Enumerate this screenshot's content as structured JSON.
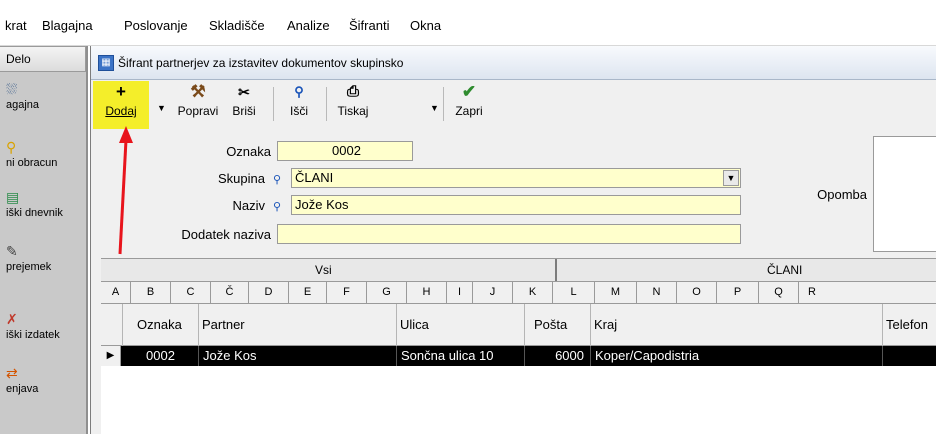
{
  "menubar": {
    "items": [
      "krat",
      "Blagajna",
      "Poslovanje",
      "Skladišče",
      "Analize",
      "Šifranti",
      "Okna"
    ]
  },
  "leftpanel": {
    "header": "Delo",
    "items": [
      {
        "label": "agajna",
        "icon": "cash-register-icon"
      },
      {
        "label": "ni obracun",
        "icon": "key-icon"
      },
      {
        "label": "iški dnevnik",
        "icon": "ledger-icon"
      },
      {
        "label": "prejemek",
        "icon": "receipt-icon"
      },
      {
        "label": "iški izdatek",
        "icon": "expense-icon"
      },
      {
        "label": "enjava",
        "icon": "exchange-icon"
      }
    ]
  },
  "window": {
    "title": "Šifrant partnerjev za izstavitev dokumentov skupinsko"
  },
  "toolbar": {
    "dodaj": "Dodaj",
    "popravi": "Popravi",
    "brisi": "Briši",
    "isci": "Išči",
    "tiskaj": "Tiskaj",
    "zapri": "Zapri",
    "highlight_color": "#f4ee2a"
  },
  "form": {
    "oznaka_label": "Oznaka",
    "oznaka_value": "0002",
    "skupina_label": "Skupina",
    "skupina_value": "ČLANI",
    "naziv_label": "Naziv",
    "naziv_value": "Jože Kos",
    "dodatek_label": "Dodatek naziva",
    "dodatek_value": "",
    "opomba_label": "Opomba"
  },
  "group_tabs": [
    "Vsi",
    "ČLANI"
  ],
  "letter_tabs": [
    "A",
    "B",
    "C",
    "Č",
    "D",
    "E",
    "F",
    "G",
    "H",
    "I",
    "J",
    "K",
    "L",
    "M",
    "N",
    "O",
    "P",
    "Q",
    "R"
  ],
  "grid": {
    "columns": [
      "Oznaka",
      "Partner",
      "Ulica",
      "Pošta",
      "Kraj",
      "Telefon"
    ],
    "rows": [
      [
        "0002",
        "Jože Kos",
        "Sončna ulica 10",
        "6000",
        "Koper/Capodistria",
        ""
      ]
    ],
    "row_indicator": "▶"
  },
  "annotation_color": "#e8141c"
}
